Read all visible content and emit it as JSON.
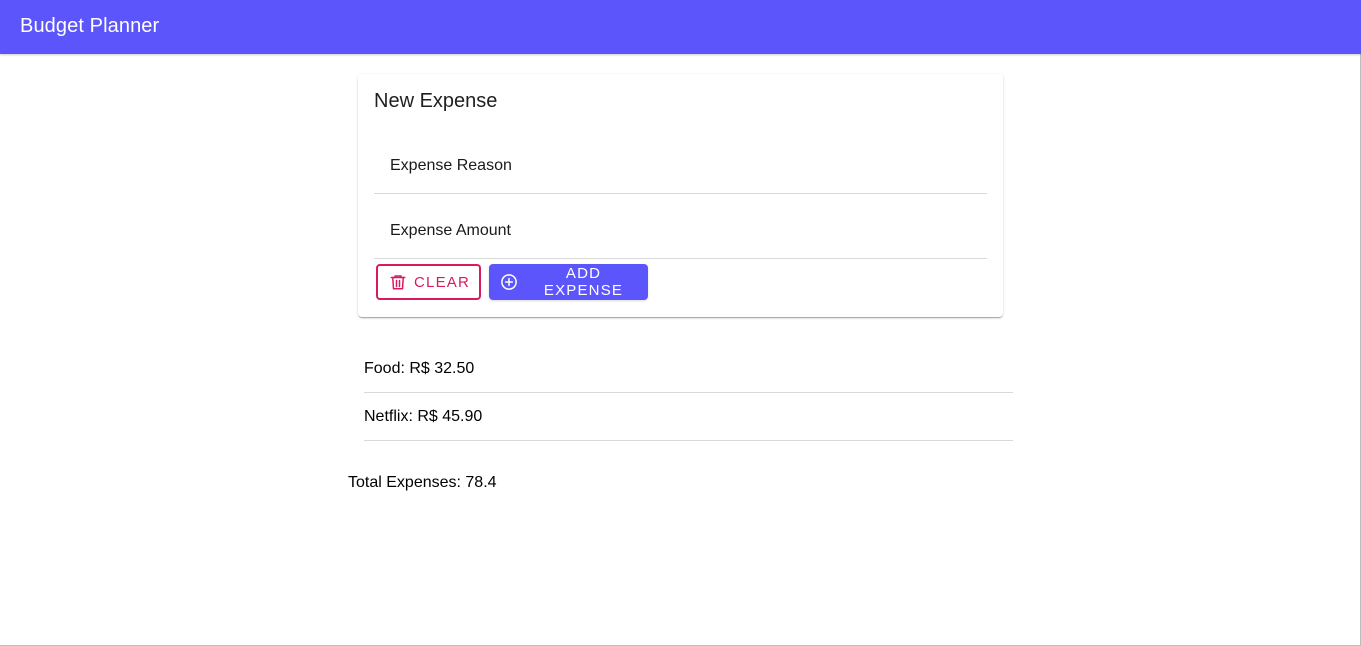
{
  "app": {
    "title": "Budget Planner",
    "accent_color": "#5b55fb",
    "warn_color": "#d81b60"
  },
  "form": {
    "title": "New Expense",
    "reason_placeholder": "Expense Reason",
    "amount_placeholder": "Expense Amount",
    "reason_value": "",
    "amount_value": "",
    "clear_label": "Clear",
    "clear_icon": "trash-icon",
    "add_label": "Add Expense",
    "add_icon": "add-circle-icon"
  },
  "expenses": [
    {
      "label": "Food: R$ 32.50"
    },
    {
      "label": "Netflix: R$ 45.90"
    }
  ],
  "total": {
    "label": "Total Expenses: 78.4"
  }
}
